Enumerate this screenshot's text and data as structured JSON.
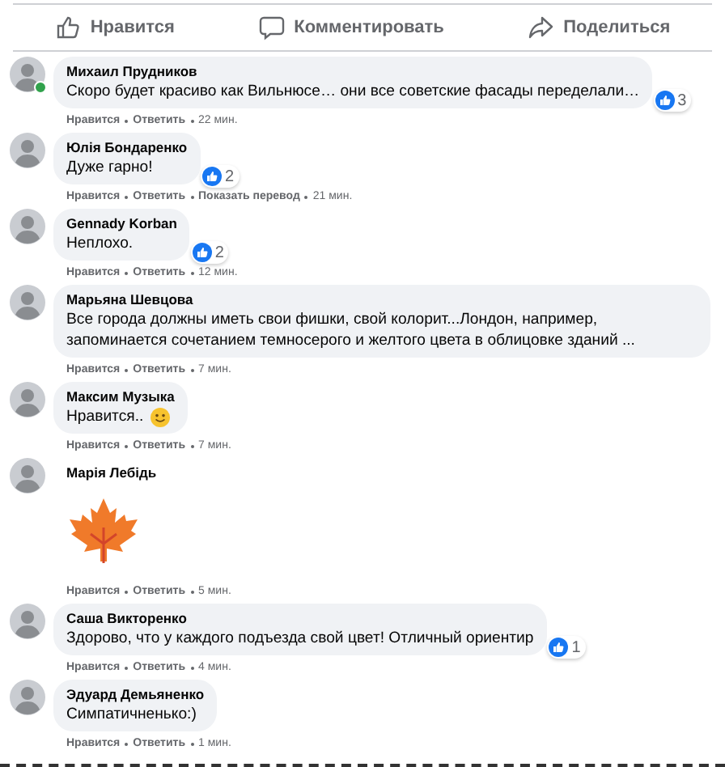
{
  "actions_bar": [
    {
      "kind": "like",
      "label": "Нравится"
    },
    {
      "kind": "comment",
      "label": "Комментировать"
    },
    {
      "kind": "share",
      "label": "Поделиться"
    }
  ],
  "comments": [
    {
      "author": "Михаил Прудников",
      "online": true,
      "kind": "text",
      "text": "Скоро будет красиво как Вильнюсе… они все советские фасады переделали…",
      "emoji": false,
      "reactions": "3",
      "actions": [
        "Нравится",
        "Ответить"
      ],
      "time": "22 мин."
    },
    {
      "author": "Юлія Бондаренко",
      "online": false,
      "kind": "text",
      "text": "Дуже гарно!",
      "emoji": false,
      "reactions": "2",
      "actions": [
        "Нравится",
        "Ответить",
        "Показать перевод"
      ],
      "time": "21 мин."
    },
    {
      "author": "Gennady Korban",
      "online": false,
      "kind": "text",
      "text": "Неплохо.",
      "emoji": false,
      "reactions": "2",
      "actions": [
        "Нравится",
        "Ответить"
      ],
      "time": "12 мин."
    },
    {
      "author": "Марьяна Шевцова",
      "online": false,
      "kind": "text",
      "text": "Все города должны иметь свои фишки, свой колорит...Лондон, например, запоминается сочетанием темносерого и желтого цвета в облицовке зданий ...",
      "emoji": false,
      "actions": [
        "Нравится",
        "Ответить"
      ],
      "time": "7 мин."
    },
    {
      "author": "Максим Музыка",
      "online": false,
      "kind": "text",
      "text": "Нравится..",
      "emoji": true,
      "actions": [
        "Нравится",
        "Ответить"
      ],
      "time": "7 мин."
    },
    {
      "author": "Марія Лебідь",
      "online": false,
      "kind": "sticker",
      "actions": [
        "Нравится",
        "Ответить"
      ],
      "time": "5 мин."
    },
    {
      "author": "Саша Викторенко",
      "online": false,
      "kind": "text",
      "text": "Здорово, что у каждого подъезда свой цвет! Отличный ориентир",
      "emoji": false,
      "reactions": "1",
      "actions": [
        "Нравится",
        "Ответить"
      ],
      "time": "4 мин."
    },
    {
      "author": "Эдуард Демьяненко",
      "online": false,
      "kind": "text",
      "text": "Симпатичненько:)",
      "emoji": false,
      "actions": [
        "Нравится",
        "Ответить"
      ],
      "time": "1 мин."
    }
  ]
}
